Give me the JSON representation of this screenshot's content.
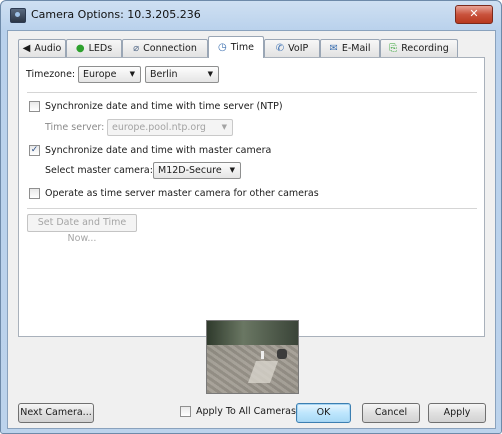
{
  "window": {
    "title": "Camera Options: 10.3.205.236",
    "close_glyph": "✕"
  },
  "tabs": [
    {
      "label": "Audio",
      "icon": "speaker-icon",
      "glyph": "◀",
      "active": false
    },
    {
      "label": "LEDs",
      "icon": "led-icon",
      "glyph": "●",
      "active": false
    },
    {
      "label": "Connection",
      "icon": "connection-icon",
      "glyph": "⌀",
      "active": false
    },
    {
      "label": "Time",
      "icon": "clock-icon",
      "glyph": "◷",
      "active": true
    },
    {
      "label": "VoIP",
      "icon": "phone-icon",
      "glyph": "✆",
      "active": false
    },
    {
      "label": "E-Mail",
      "icon": "envelope-icon",
      "glyph": "✉",
      "active": false
    },
    {
      "label": "Recording",
      "icon": "recording-icon",
      "glyph": "⎘",
      "active": false
    }
  ],
  "time": {
    "timezone_label": "Timezone:",
    "timezone_region": "Europe",
    "timezone_city": "Berlin",
    "ntp_sync_label": "Synchronize date and time with time server (NTP)",
    "ntp_sync_checked": false,
    "time_server_label": "Time server:",
    "time_server_value": "europe.pool.ntp.org",
    "master_sync_label": "Synchronize date and time with master camera",
    "master_sync_checked": true,
    "master_camera_label": "Select master camera:",
    "master_camera_value": "M12D-Secure",
    "time_master_label": "Operate as time server master camera for other cameras",
    "time_master_checked": false,
    "set_now_label": "Set Date and Time Now..."
  },
  "footer": {
    "next_camera": "Next Camera...",
    "apply_all_label": "Apply To All Cameras",
    "apply_all_checked": false,
    "ok": "OK",
    "cancel": "Cancel",
    "apply": "Apply"
  },
  "colors": {
    "titlebar": "#b9d1ec",
    "close": "#c9523c",
    "default_button": "#bee6fd"
  }
}
